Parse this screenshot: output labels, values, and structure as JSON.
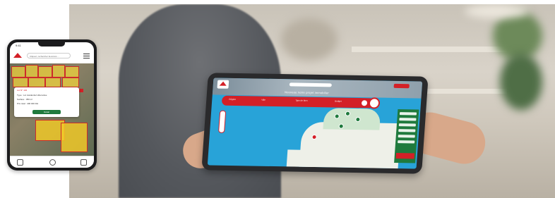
{
  "tablet": {
    "title": "Nouveau notre projet immobilier",
    "tabs": [
      "Région",
      "Ville",
      "Type de bien",
      "Budget"
    ],
    "panel_items": 6
  },
  "phone": {
    "time": "9:41",
    "search_placeholder": "Cliquez, rechercher lieux/vos ...",
    "card": {
      "header": "Lot N° 132",
      "line1": "Type : Lot résidentiel villa isolée",
      "line2": "Surface : 350 m²",
      "line3": "Prix total : 400 000 DH",
      "button": "Détail"
    }
  },
  "colors": {
    "brand_red": "#d32027",
    "brand_green": "#1f7a3d",
    "sea_blue": "#28a3d8"
  }
}
